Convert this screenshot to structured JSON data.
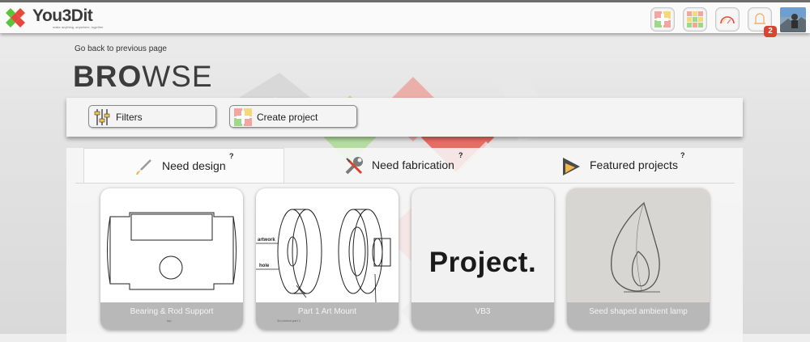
{
  "header": {
    "logo_text": "You3Dit",
    "logo_tagline": "make anything, anywhere, together",
    "notification_count": "2"
  },
  "page": {
    "back_link": "Go back to previous page",
    "title_bold": "BRO",
    "title_light": "WSE"
  },
  "toolbar": {
    "filters_label": "Filters",
    "create_label": "Create project"
  },
  "tabs": [
    {
      "label": "Need design",
      "help": "?"
    },
    {
      "label": "Need fabrication",
      "help": "?"
    },
    {
      "label": "Featured projects",
      "help": "?"
    }
  ],
  "cards": [
    {
      "title": "Bearing & Rod Support",
      "subtitle": "top"
    },
    {
      "title": "Part 1 Art Mount",
      "subtitle": "3d printed part 1",
      "labels": [
        "artwork",
        "hole"
      ]
    },
    {
      "title": "VB3",
      "image_text": "Project."
    },
    {
      "title": "Seed shaped ambient lamp"
    }
  ],
  "colors": {
    "brand_green": "#5cc43a",
    "brand_red": "#e8473b",
    "badge_red": "#d9432f",
    "caption_gray": "#b8b8b8"
  }
}
